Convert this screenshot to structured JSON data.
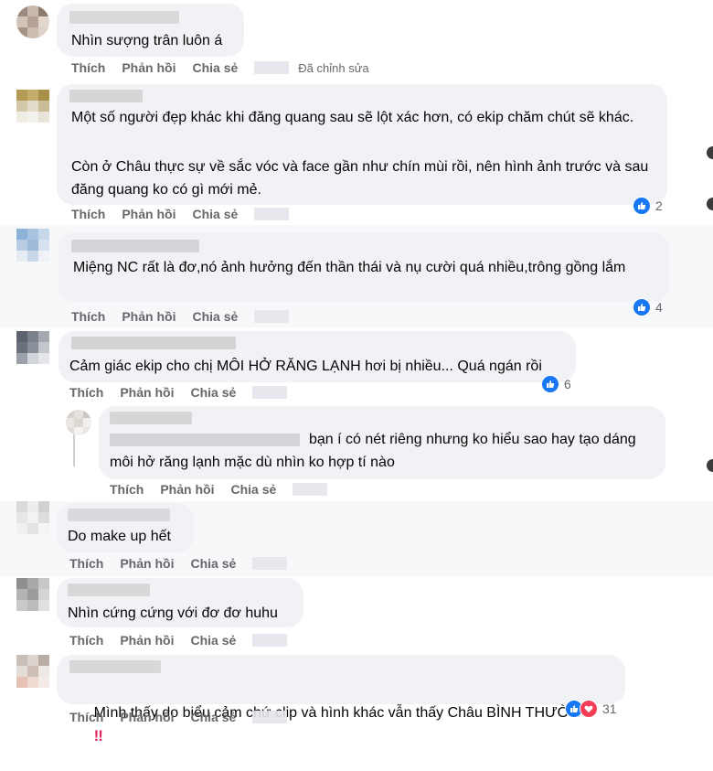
{
  "actions": {
    "like": "Thích",
    "reply": "Phản hồi",
    "share": "Chia sẻ",
    "edited": "Đã chỉnh sửa"
  },
  "comments": [
    {
      "name": "T",
      "text": "Nhìn sượng trân luôn á",
      "reactions": ""
    },
    {
      "name": "T",
      "text": "Một số người đẹp khác khi đăng quang sau sẽ lột xác hơn, có ekip chăm chút sẽ khác.",
      "text2": "Còn ở Châu thực sự về sắc vóc và face gần như chín mùi rồi, nên hình ảnh trước và sau đăng quang ko có gì mới mẻ.",
      "reactions": "2"
    },
    {
      "name": "",
      "text": "Miệng NC rất là đơ,nó ảnh hưởng đến thần thái và nụ cười quá nhiều,trông gồng lắm",
      "reactions": "4"
    },
    {
      "name": "",
      "text": "Cảm giác ekip cho chị MÔI HỞ RĂNG LẠNH hơi bị nhiều... Quá ngán rồi",
      "reactions": "6"
    },
    {
      "name": "",
      "text": "bạn í có nét riêng nhưng ko hiểu sao hay tạo dáng môi hở răng lạnh mặc dù nhìn ko hợp tí nào",
      "reactions": ""
    },
    {
      "name": "",
      "text": "Do make up hết",
      "reactions": ""
    },
    {
      "name": "N",
      "text": "Nhìn cứng cứng với đơ đơ huhu",
      "reactions": ""
    },
    {
      "name": "M",
      "text": "Mình thấy do biểu cảm chứ clip và hình khác vẫn thấy Châu BÌNH THƯỜNG",
      "emoji": "‼",
      "reactions": "31"
    }
  ],
  "colors": {
    "bubble": "#f0f2f5",
    "like_blue": "#1877f2",
    "love_red": "#f33e58",
    "meta_gray": "#65676b"
  }
}
